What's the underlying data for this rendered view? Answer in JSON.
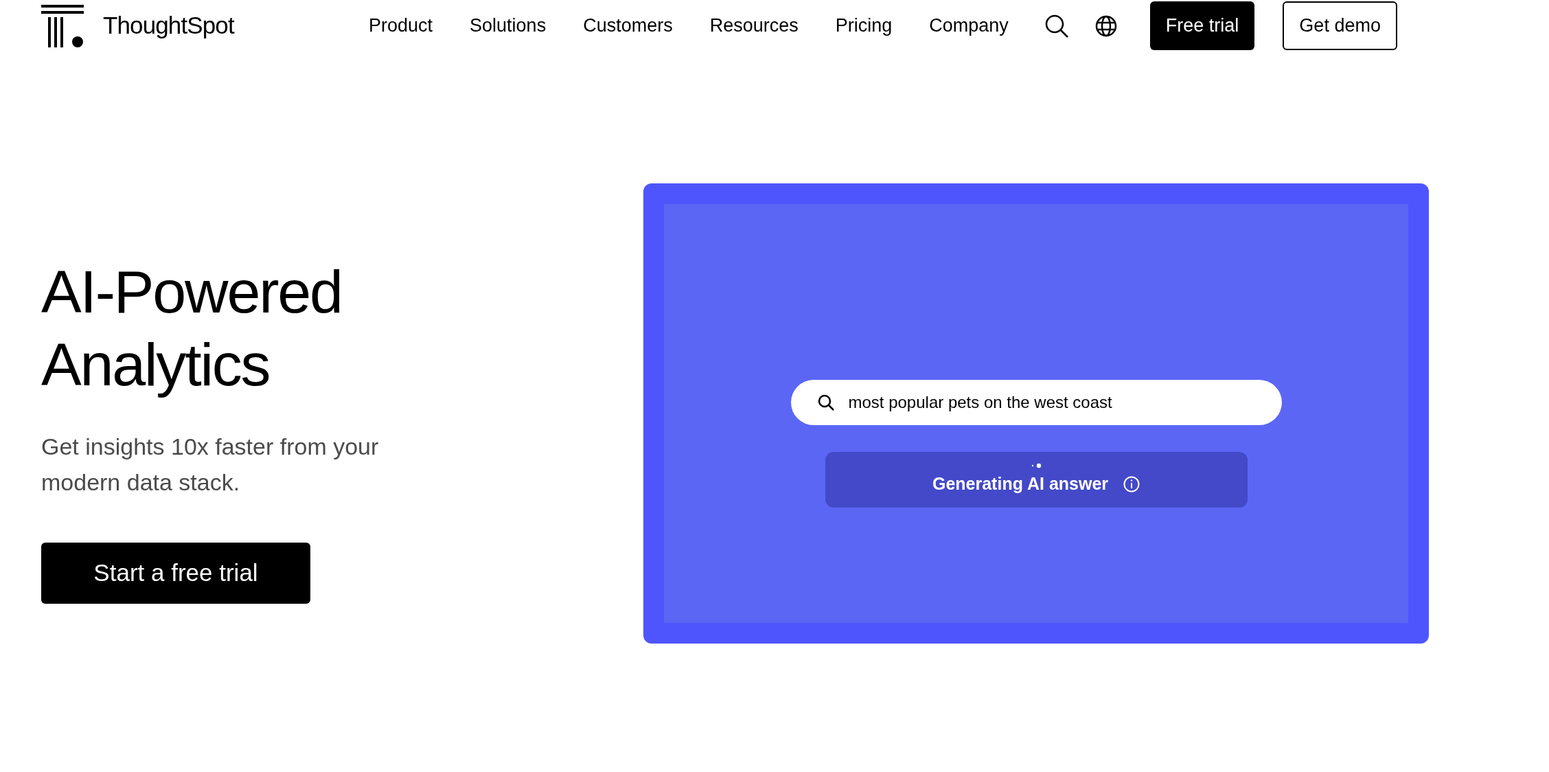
{
  "header": {
    "brand": "ThoughtSpot",
    "nav": [
      "Product",
      "Solutions",
      "Customers",
      "Resources",
      "Pricing",
      "Company"
    ],
    "buttons": [
      {
        "label": "Free trial",
        "kind": "primary"
      },
      {
        "label": "Get demo",
        "kind": "outline"
      }
    ]
  },
  "hero": {
    "title_lines": [
      "AI-Powered",
      "Analytics"
    ],
    "subtitle": "Get insights 10x faster from your modern data stack.",
    "cta": "Start a free trial"
  },
  "demo": {
    "query": "most popular pets on the west coast",
    "status": "Generating AI answer"
  }
}
